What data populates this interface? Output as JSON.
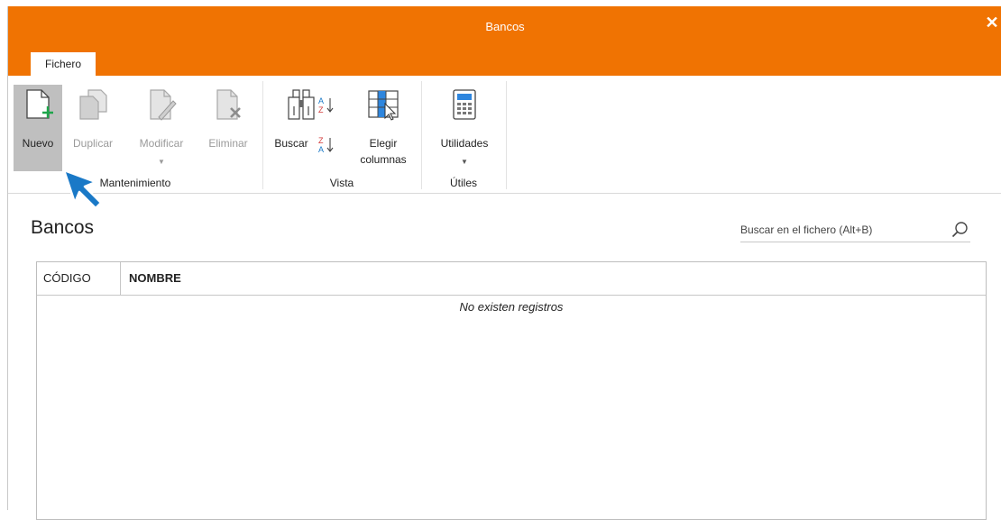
{
  "window": {
    "title": "Bancos",
    "close_label": "✕"
  },
  "tabs": [
    {
      "label": "Fichero"
    }
  ],
  "ribbon": {
    "mantenimiento": {
      "label": "Mantenimiento",
      "buttons": [
        {
          "label": "Nuevo",
          "icon": "new-document-icon",
          "enabled": true
        },
        {
          "label": "Duplicar",
          "icon": "duplicate-icon",
          "enabled": false
        },
        {
          "label": "Modificar",
          "icon": "edit-icon",
          "enabled": false
        },
        {
          "label": "Eliminar",
          "icon": "delete-icon",
          "enabled": false
        }
      ]
    },
    "vista": {
      "label": "Vista",
      "buttons": [
        {
          "label": "Buscar",
          "icon": "binoculars-icon"
        },
        {
          "label": "Elegir\ncolumnas",
          "label_line1": "Elegir",
          "label_line2": "columnas",
          "icon": "choose-columns-icon"
        }
      ]
    },
    "utiles": {
      "label": "Útiles",
      "buttons": [
        {
          "label": "Utilidades",
          "icon": "calculator-icon"
        }
      ]
    }
  },
  "main": {
    "title": "Bancos",
    "search": {
      "placeholder": "Buscar en el fichero (Alt+B)"
    },
    "table": {
      "columns": [
        "CÓDIGO",
        "NOMBRE"
      ],
      "rows": [],
      "empty_message": "No existen registros"
    }
  },
  "colors": {
    "accent": "#f07302",
    "selected_button": "#bfbfbf",
    "pointer": "#1a79c7"
  }
}
